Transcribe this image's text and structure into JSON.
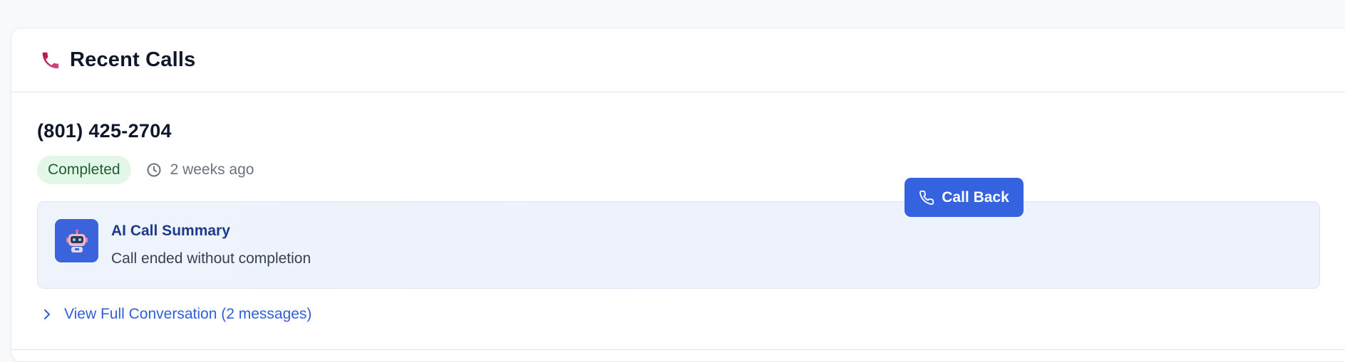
{
  "header": {
    "title": "Recent Calls",
    "icon": "phone-icon"
  },
  "call": {
    "phone_number": "(801) 425-2704",
    "status": "Completed",
    "time_ago": "2 weeks ago",
    "call_back_label": "Call Back",
    "summary": {
      "title": "AI Call Summary",
      "text": "Call ended without completion",
      "icon": "robot-icon"
    },
    "view_conversation_label": "View Full Conversation (2 messages)"
  },
  "colors": {
    "accent": "#3563e0",
    "status_bg": "#e3f7e8",
    "status_text": "#1f5e33",
    "summary_title": "#1e3a8a",
    "link": "#2f5fd6",
    "phone_icon": "#c2185b"
  }
}
